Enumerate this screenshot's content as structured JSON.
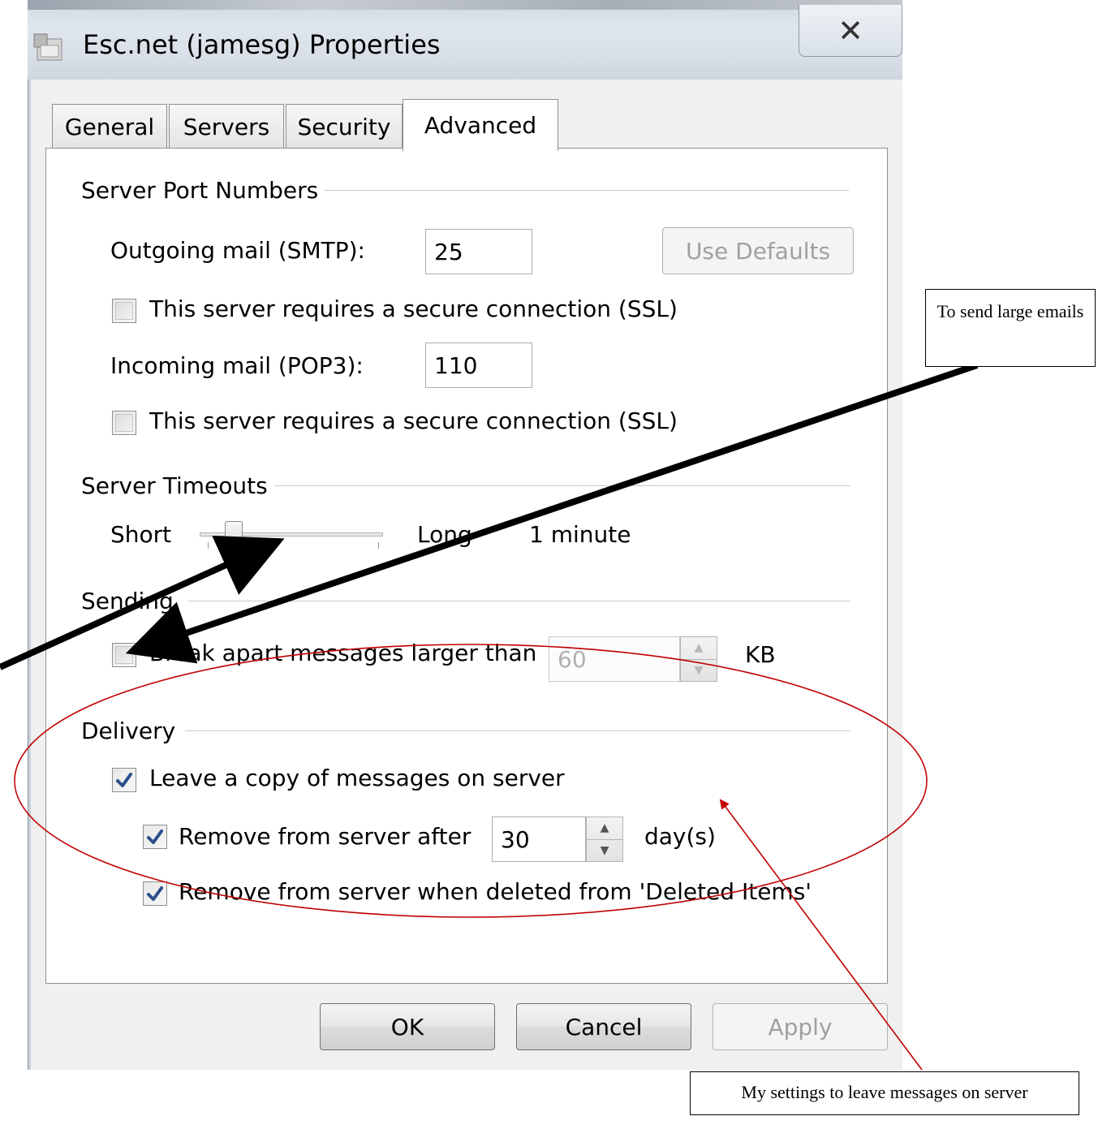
{
  "window": {
    "title": "Esc.net (jamesg) Properties",
    "close_glyph": "✕"
  },
  "tabs": [
    {
      "label": "General"
    },
    {
      "label": "Servers"
    },
    {
      "label": "Security"
    },
    {
      "label": "Advanced",
      "selected": true
    }
  ],
  "port_numbers": {
    "heading": "Server Port Numbers",
    "outgoing_label": "Outgoing mail (SMTP):",
    "outgoing_value": "25",
    "use_defaults_label": "Use Defaults",
    "ssl_outgoing_label": "This server requires a secure connection (SSL)",
    "ssl_outgoing_checked": false,
    "incoming_label": "Incoming mail (POP3):",
    "incoming_value": "110",
    "ssl_incoming_label": "This server requires a secure connection (SSL)",
    "ssl_incoming_checked": false
  },
  "timeouts": {
    "heading": "Server Timeouts",
    "short_label": "Short",
    "long_label": "Long",
    "value_text": "1 minute",
    "slider_fraction": 0.15
  },
  "sending": {
    "heading": "Sending",
    "break_label": "Break apart messages larger than",
    "break_checked": false,
    "break_value": "60",
    "unit": "KB"
  },
  "delivery": {
    "heading": "Delivery",
    "leave_copy_label": "Leave a copy of messages on server",
    "leave_copy_checked": true,
    "remove_after_label": "Remove from server after",
    "remove_after_checked": true,
    "remove_after_value": "30",
    "days_label": "day(s)",
    "remove_deleted_label": "Remove from server when deleted from 'Deleted Items'",
    "remove_deleted_checked": true
  },
  "buttons": {
    "ok": "OK",
    "cancel": "Cancel",
    "apply": "Apply"
  },
  "annotations": {
    "large_emails_note": "To send large emails",
    "settings_note": "My settings to leave messages on server",
    "ellipse_color": "#c00000",
    "arrow_color": "#000000"
  }
}
